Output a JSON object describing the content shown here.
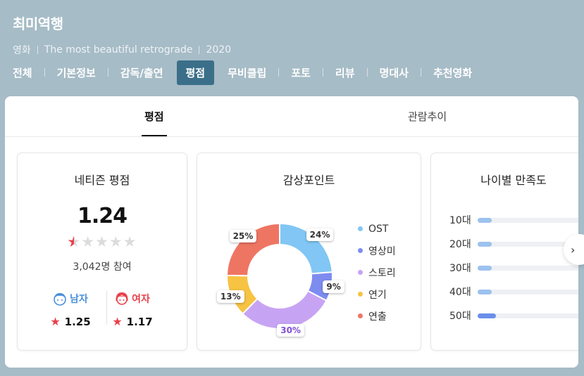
{
  "movie": {
    "title": "최미역행",
    "category": "영화",
    "original_title": "The most beautiful retrograde",
    "year": "2020"
  },
  "nav": [
    {
      "label": "전체"
    },
    {
      "label": "기본정보"
    },
    {
      "label": "감독/출연"
    },
    {
      "label": "평점",
      "active": true
    },
    {
      "label": "무비클립"
    },
    {
      "label": "포토"
    },
    {
      "label": "리뷰"
    },
    {
      "label": "명대사"
    },
    {
      "label": "추천영화"
    }
  ],
  "tabs": {
    "score": "평점",
    "trend": "관람추이"
  },
  "netizen": {
    "title": "네티즌 평점",
    "score": "1.24",
    "stars_filled_fraction": 0.25,
    "participants": "3,042명 참여",
    "male": {
      "label": "남자",
      "score": "1.25",
      "icon": "male-face-icon"
    },
    "female": {
      "label": "여자",
      "score": "1.17",
      "icon": "female-face-icon"
    }
  },
  "points": {
    "title": "감상포인트",
    "chart_data": {
      "type": "pie",
      "categories": [
        "OST",
        "영상미",
        "스토리",
        "연기",
        "연출"
      ],
      "values": [
        24,
        9,
        30,
        13,
        25
      ],
      "labels": [
        "24%",
        "9%",
        "30%",
        "13%",
        "25%"
      ],
      "colors": [
        "#81c6f4",
        "#7e8cf0",
        "#c7a4f3",
        "#f7c343",
        "#ef7563"
      ],
      "highlight_index": 2
    }
  },
  "age": {
    "title": "나이별 만족도",
    "chart_data": {
      "type": "bar",
      "categories": [
        "10대",
        "20대",
        "30대",
        "40대",
        "50대"
      ],
      "values": [
        0.12,
        0.12,
        0.12,
        0.12,
        0.15
      ],
      "colors": [
        "#9cc2ee",
        "#9cc2ee",
        "#9cc2ee",
        "#9cc2ee",
        "#6a8fea"
      ]
    }
  },
  "next_button_icon": "chevron-right-icon"
}
